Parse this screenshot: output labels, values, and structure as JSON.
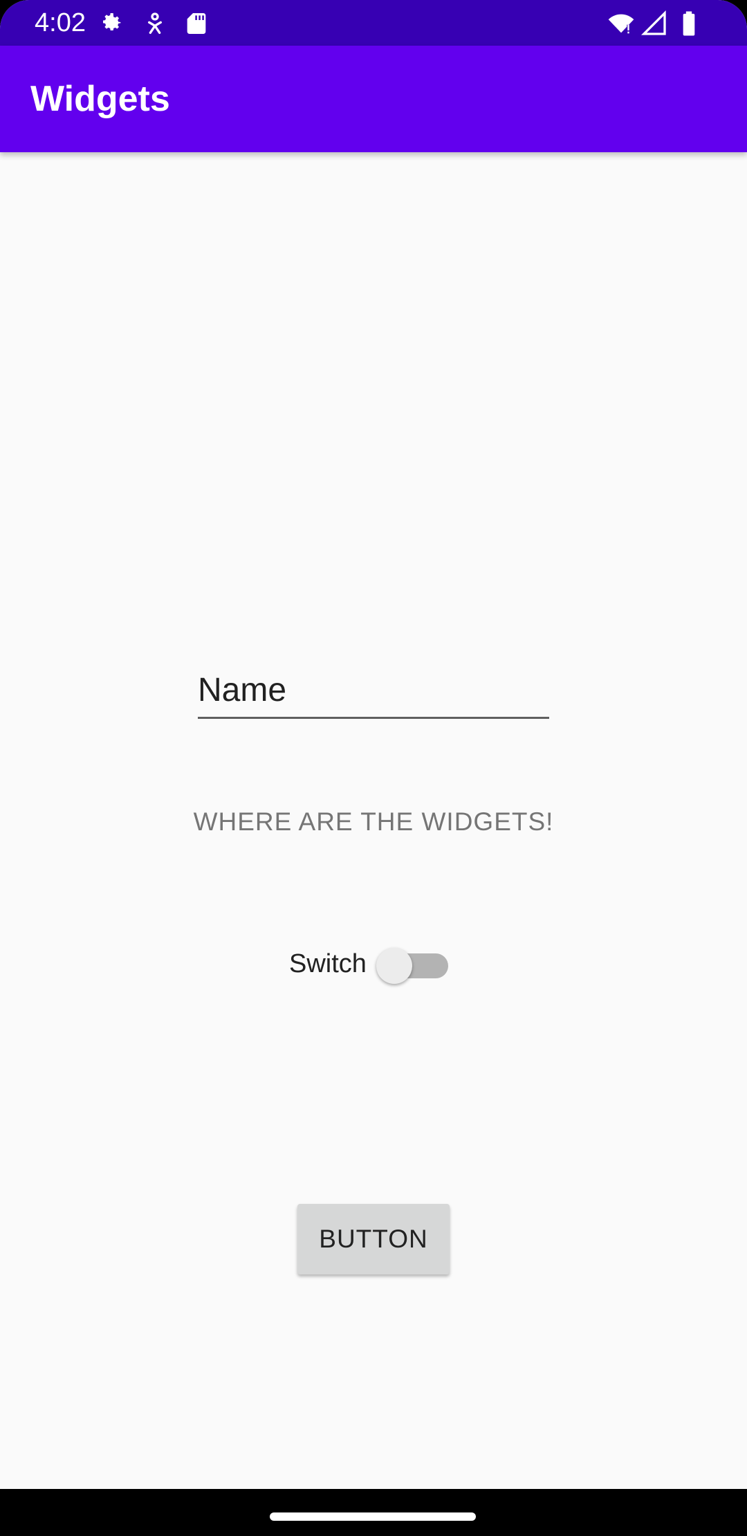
{
  "status_bar": {
    "time": "4:02",
    "icons": [
      "settings-gear-icon",
      "accessibility-icon",
      "sd-card-icon",
      "wifi-icon",
      "cell-signal-icon",
      "battery-icon"
    ],
    "background_color": "#3700b3"
  },
  "app_bar": {
    "title": "Widgets",
    "background_color": "#6200ee"
  },
  "name_field": {
    "placeholder": "Name",
    "value": ""
  },
  "widgets_label": {
    "text": "WHERE ARE THE WIDGETS!"
  },
  "switch": {
    "label": "Switch",
    "checked": false
  },
  "button": {
    "label": "BUTTON"
  }
}
